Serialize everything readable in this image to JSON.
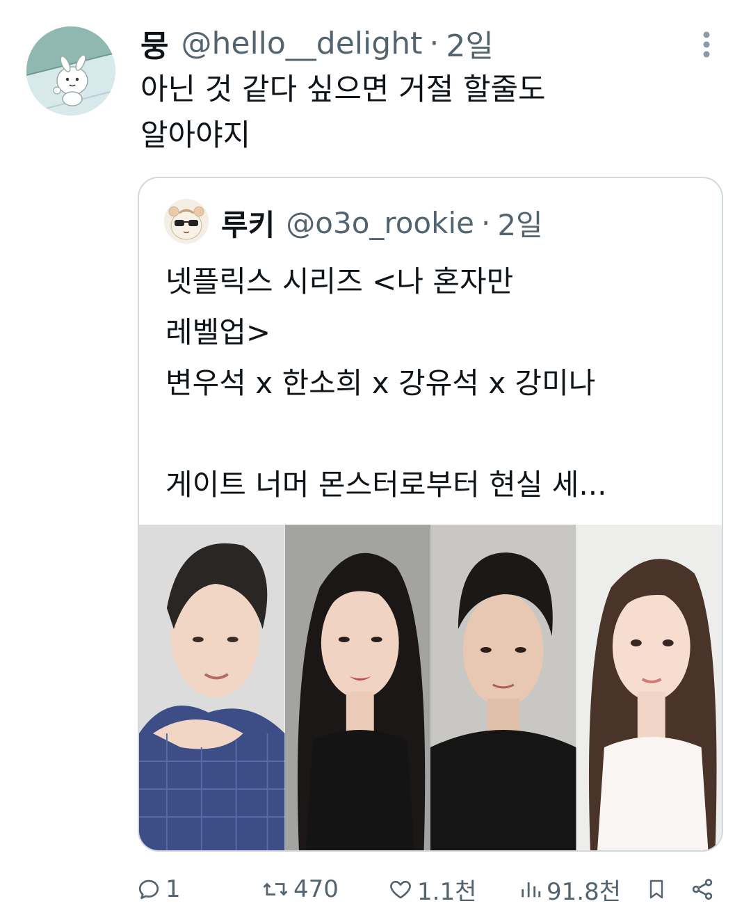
{
  "tweet": {
    "display_name": "뭉",
    "handle": "@hello__delight",
    "separator": "·",
    "time": "2일",
    "text": "아닌 것 같다 싶으면 거절 할줄도\n알아야지",
    "avatar_icon": "white-rabbit-avatar",
    "more_icon": "vertical-ellipsis-icon"
  },
  "quote": {
    "display_name": "루키",
    "handle": "@o3o_rookie",
    "separator": "·",
    "time": "2일",
    "text": "넷플릭스 시리즈 <나 혼자만\n레벨업>\n변우석 x 한소희 x 강유석 x 강미나\n\n게이트 너머 몬스터로부터 현실 세...",
    "avatar_icon": "hamster-sunglasses-avatar",
    "media": {
      "panels": [
        "actor-photo-1",
        "actor-photo-2",
        "actor-photo-3",
        "actor-photo-4"
      ]
    }
  },
  "actions": {
    "reply_count": "1",
    "retweet_count": "470",
    "like_count": "1.1천",
    "view_count": "91.8천"
  },
  "colors": {
    "text": "#0f1419",
    "muted": "#536471",
    "border": "#cfd9de"
  }
}
